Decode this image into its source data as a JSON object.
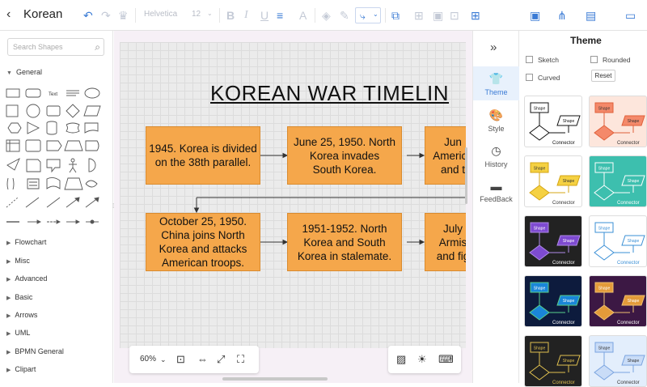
{
  "app": {
    "title": "Korean \\",
    "back_glyph": "‹"
  },
  "toolbar": {
    "font_name": "Helvetica",
    "font_size": "12"
  },
  "left_panel": {
    "search_placeholder": "Search Shapes",
    "categories": [
      "General",
      "Flowchart",
      "Misc",
      "Advanced",
      "Basic",
      "Arrows",
      "UML",
      "BPMN General",
      "Clipart"
    ],
    "shape_text_label": "Text"
  },
  "diagram": {
    "title": "KOREAN WAR TIMELIN",
    "row1": [
      "1945. Korea is divided\non the 38th parallel.",
      "June 25, 1950. North\nKorea invades\nSouth Korea.",
      "Jun\nAmerica\nand t"
    ],
    "row2": [
      "October 25, 1950.\nChina joins North\nKorea and attacks\nAmerican troops.",
      "1951-1952. North\nKorea and South\nKorea in stalemate.",
      "July\nArmis\nand fig"
    ],
    "box_color": "#f5a74b"
  },
  "bottom": {
    "zoom_level": "60%"
  },
  "side_nav": [
    {
      "label": "Theme",
      "icon": "shirt-icon",
      "active": true
    },
    {
      "label": "Style",
      "icon": "palette-icon",
      "active": false
    },
    {
      "label": "History",
      "icon": "clock-icon",
      "active": false
    },
    {
      "label": "FeedBack",
      "icon": "chat-icon",
      "active": false
    }
  ],
  "theme_panel": {
    "title": "Theme",
    "options": {
      "sketch": "Sketch",
      "rounded": "Rounded",
      "curved": "Curved",
      "reset": "Reset"
    },
    "card_text": {
      "shape": "Shape",
      "connector": "Connector"
    },
    "cards": [
      {
        "bg": "#ffffff",
        "node": "#ffffff",
        "stroke": "#111111",
        "text": "#111111"
      },
      {
        "bg": "#fde6dc",
        "node": "#f4896a",
        "stroke": "#e0603a",
        "text": "#333333"
      },
      {
        "bg": "#ffffff",
        "node": "#f5d142",
        "stroke": "#d4a514",
        "text": "#333333"
      },
      {
        "bg": "#3dbfae",
        "node": "#3dbfae",
        "stroke": "#ffffff",
        "text": "#ffffff"
      },
      {
        "bg": "#222222",
        "node": "#7e4bd1",
        "stroke": "#b08be8",
        "text": "#ffffff"
      },
      {
        "bg": "#ffffff",
        "node": "#ffffff",
        "stroke": "#3a8fd5",
        "text": "#3a8fd5"
      },
      {
        "bg": "#0d1b3d",
        "node": "#1a86d8",
        "stroke": "#5ad18a",
        "text": "#ffffff"
      },
      {
        "bg": "#3c1844",
        "node": "#e39b3a",
        "stroke": "#f0c070",
        "text": "#ffffff"
      },
      {
        "bg": "#222222",
        "node": "#222222",
        "stroke": "#e0c050",
        "text": "#e0c050"
      },
      {
        "bg": "#e3eefc",
        "node": "#c9dcf7",
        "stroke": "#7aa4e0",
        "text": "#333333"
      }
    ]
  }
}
